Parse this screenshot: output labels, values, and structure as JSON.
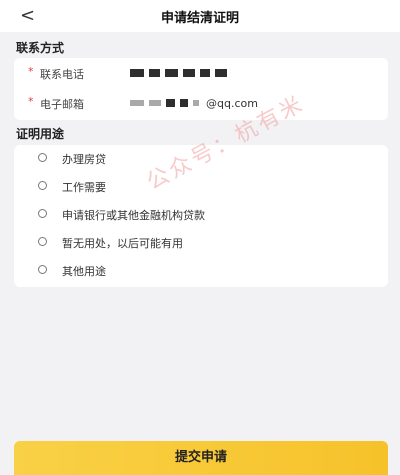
{
  "header": {
    "title": "申请结清证明",
    "back_icon": "chevron-left-icon",
    "back_glyph": "<"
  },
  "contact": {
    "section_title": "联系方式",
    "phone": {
      "required_mark": "*",
      "label": "联系电话"
    },
    "email": {
      "required_mark": "*",
      "label": "电子邮箱",
      "value_suffix": "@qq.com"
    }
  },
  "purpose": {
    "section_title": "证明用途",
    "options": [
      {
        "label": "办理房贷",
        "selected": false
      },
      {
        "label": "工作需要",
        "selected": false
      },
      {
        "label": "申请银行或其他金融机构贷款",
        "selected": false
      },
      {
        "label": "暂无用处，以后可能有用",
        "selected": false
      },
      {
        "label": "其他用途",
        "selected": false
      }
    ]
  },
  "watermark": "公众号：杭有米",
  "submit_label": "提交申请",
  "colors": {
    "accent": "#f7c933",
    "required": "#e23c3c",
    "background": "#f2f2f4"
  }
}
